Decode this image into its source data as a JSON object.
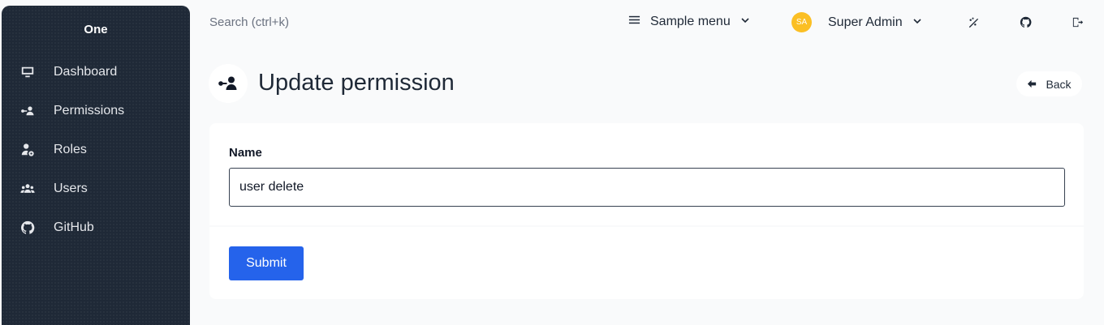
{
  "sidebar": {
    "brand": "One",
    "items": [
      {
        "label": "Dashboard",
        "icon": "monitor-icon"
      },
      {
        "label": "Permissions",
        "icon": "user-key-icon"
      },
      {
        "label": "Roles",
        "icon": "user-gear-icon"
      },
      {
        "label": "Users",
        "icon": "users-icon"
      },
      {
        "label": "GitHub",
        "icon": "github-icon"
      }
    ],
    "background": "#1f2937"
  },
  "header": {
    "search_placeholder": "Search (ctrl+k)",
    "menu_label": "Sample menu",
    "avatar_initials": "SA",
    "user_name": "Super Admin",
    "icons": [
      "theme-toggle-icon",
      "github-icon",
      "logout-icon"
    ]
  },
  "page": {
    "title": "Update permission",
    "back_label": "Back"
  },
  "form": {
    "name_label": "Name",
    "name_value": "user delete",
    "submit_label": "Submit"
  },
  "colors": {
    "accent": "#2563eb",
    "avatar": "#fbbf24"
  }
}
